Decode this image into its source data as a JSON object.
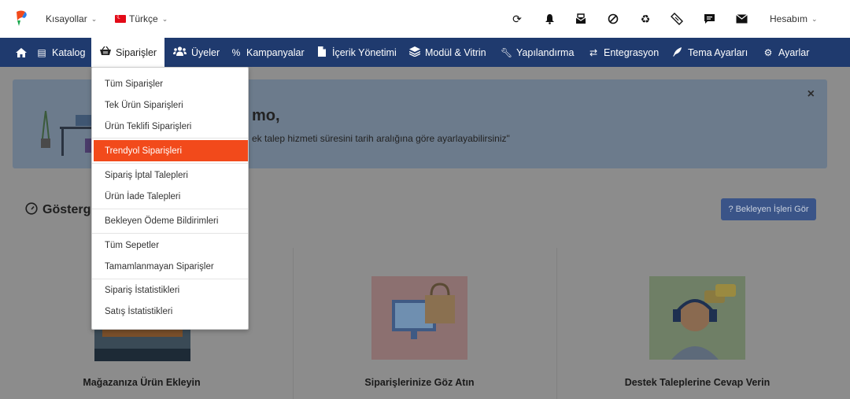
{
  "topbar": {
    "shortcuts_label": "Kısayollar",
    "language_label": "Türkçe",
    "account_label": "Hesabım",
    "icons": [
      "refresh-icon",
      "bell-icon",
      "mailbox-icon",
      "ban-icon",
      "recycle-icon",
      "ticket-icon",
      "comment-icon",
      "envelope-icon"
    ]
  },
  "nav": {
    "items": [
      {
        "label": "Katalog",
        "icon": "file-icon"
      },
      {
        "label": "Siparişler",
        "icon": "basket-icon"
      },
      {
        "label": "Üyeler",
        "icon": "users-icon"
      },
      {
        "label": "Kampanyalar",
        "icon": "percent-icon"
      },
      {
        "label": "İçerik Yönetimi",
        "icon": "document-icon"
      },
      {
        "label": "Modül & Vitrin",
        "icon": "layers-icon"
      },
      {
        "label": "Yapılandırma",
        "icon": "wrench-icon"
      },
      {
        "label": "Entegrasyon",
        "icon": "exchange-icon"
      },
      {
        "label": "Tema Ayarları",
        "icon": "feather-icon"
      },
      {
        "label": "Ayarlar",
        "icon": "gear-icon"
      }
    ]
  },
  "dropdown": {
    "items": [
      "Tüm Siparişler",
      "Tek Ürün Siparişleri",
      "Ürün Teklifi Siparişleri",
      "Trendyol Siparişleri",
      "Sipariş İptal Talepleri",
      "Ürün İade Talepleri",
      "Bekleyen Ödeme Bildirimleri",
      "Tüm Sepetler",
      "Tamamlanmayan Siparişler",
      "Sipariş İstatistikleri",
      "Satış İstatistikleri"
    ],
    "highlighted": "Trendyol Siparişleri"
  },
  "banner": {
    "title_partial": "mo,",
    "text_partial": "ek talep hizmeti süresini tarih aralığına göre ayarlayabilirsiniz\"",
    "close_symbol": "×"
  },
  "dashboard": {
    "title_partial": "Gösterge",
    "pending_button": "Bekleyen İşleri Gör",
    "cards": [
      "Mağazanıza Ürün Ekleyin",
      "Siparişlerinize Göz Atın",
      "Destek Taleplerine Cevap Verin"
    ]
  },
  "colors": {
    "nav_bg": "#1f3a6e",
    "highlight": "#f24a1b",
    "pending_button": "#3a5488"
  }
}
